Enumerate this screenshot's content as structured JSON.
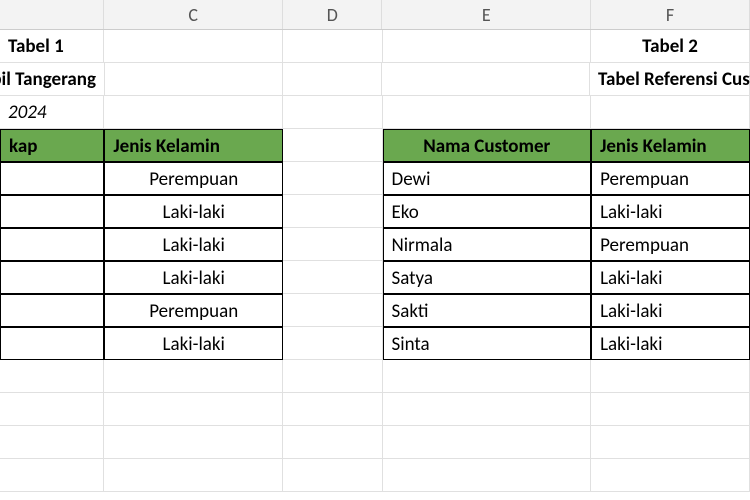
{
  "columns": {
    "C": "C",
    "D": "D",
    "E": "E",
    "F": "F"
  },
  "tabel1": {
    "title": "Tabel 1",
    "subtitle": "n Service Mobil Tangerang",
    "year": "2024",
    "headers": {
      "nama": "kap",
      "jk": "Jenis Kelamin"
    },
    "rows": [
      {
        "jk": "Perempuan"
      },
      {
        "jk": "Laki-laki"
      },
      {
        "jk": "Laki-laki"
      },
      {
        "jk": "Laki-laki"
      },
      {
        "jk": "Perempuan"
      },
      {
        "jk": "Laki-laki"
      }
    ]
  },
  "tabel2": {
    "title": "Tabel 2",
    "subtitle": "Tabel Referensi Custo",
    "headers": {
      "nama": "Nama Customer",
      "jk": "Jenis Kelamin"
    },
    "rows": [
      {
        "nama": "Dewi",
        "jk": "Perempuan"
      },
      {
        "nama": "Eko",
        "jk": "Laki-laki"
      },
      {
        "nama": "Nirmala",
        "jk": "Perempuan"
      },
      {
        "nama": "Satya",
        "jk": "Laki-laki"
      },
      {
        "nama": "Sakti",
        "jk": "Laki-laki"
      },
      {
        "nama": "Sinta",
        "jk": "Laki-laki"
      }
    ]
  }
}
